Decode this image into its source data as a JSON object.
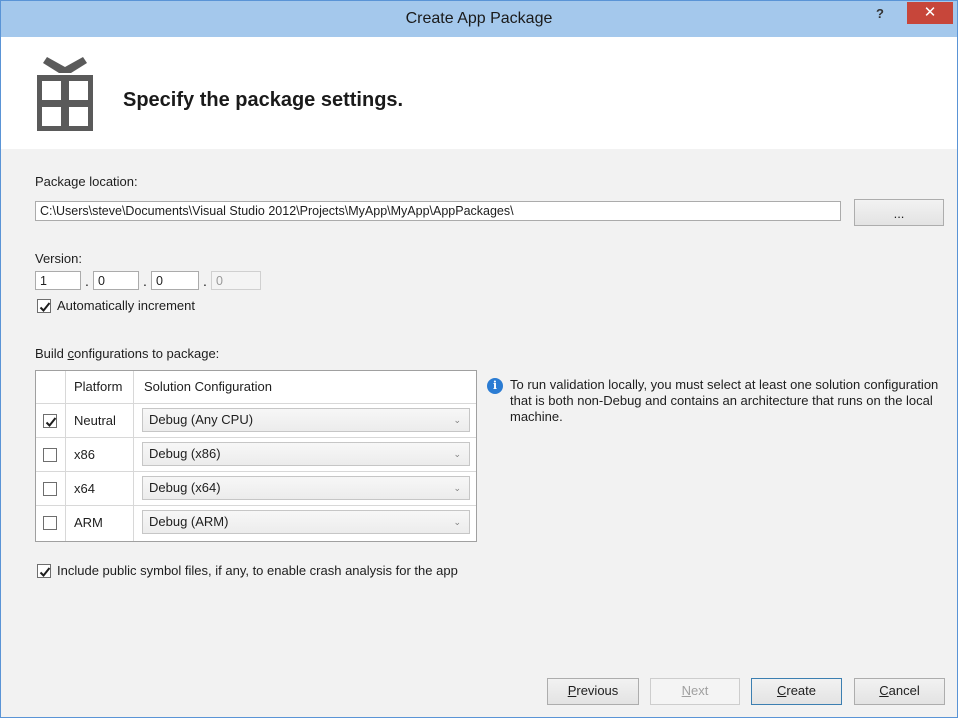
{
  "window": {
    "title": "Create App Package",
    "help_label": "?",
    "close_label": "✕"
  },
  "header": {
    "title": "Specify the package settings.",
    "icon": "package-icon"
  },
  "package_location": {
    "label": "Package location:",
    "value": "C:\\Users\\steve\\Documents\\Visual Studio 2012\\Projects\\MyApp\\MyApp\\AppPackages\\",
    "browse_label": "..."
  },
  "version": {
    "label": "Version:",
    "major": "1",
    "minor": "0",
    "build": "0",
    "revision": "0",
    "separator": ".",
    "auto_increment_label": "Automatically increment",
    "auto_increment_checked": true
  },
  "build_configs": {
    "label_prefix": "Build ",
    "label_mnemonic": "c",
    "label_suffix": "onfigurations to package:",
    "columns": [
      "Platform",
      "Solution Configuration"
    ],
    "rows": [
      {
        "checked": true,
        "platform": "Neutral",
        "configuration": "Debug (Any CPU)"
      },
      {
        "checked": false,
        "platform": "x86",
        "configuration": "Debug (x86)"
      },
      {
        "checked": false,
        "platform": "x64",
        "configuration": "Debug (x64)"
      },
      {
        "checked": false,
        "platform": "ARM",
        "configuration": "Debug (ARM)"
      }
    ],
    "dropdown_arrow": "⌄"
  },
  "info": {
    "icon": "info-icon",
    "icon_glyph": "i",
    "message": "To run validation locally, you must select at least one solution configuration that is both non-Debug and contains an architecture that runs on the local machine."
  },
  "symbols": {
    "label": "Include public symbol files, if any, to enable crash analysis for the app",
    "checked": true
  },
  "footer": {
    "previous": {
      "mnemonic": "P",
      "rest": "revious"
    },
    "next": {
      "mnemonic": "N",
      "rest": "ext"
    },
    "create": {
      "mnemonic": "C",
      "rest": "reate"
    },
    "cancel": {
      "mnemonic": "C",
      "rest": "ancel"
    }
  },
  "colors": {
    "titlebar": "#a4c8ec",
    "close_button": "#c7463a",
    "info_icon": "#2b7cd3",
    "package_icon": "#5a5a5a"
  }
}
